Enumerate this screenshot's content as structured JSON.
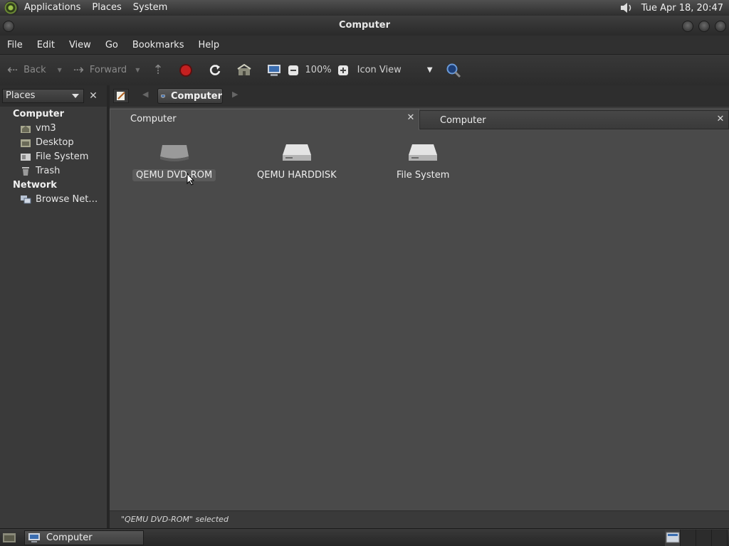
{
  "top_panel": {
    "menus": [
      "Applications",
      "Places",
      "System"
    ],
    "clock": "Tue Apr 18, 20:47",
    "icons": [
      "gnome-foot-icon",
      "volume-icon"
    ]
  },
  "window": {
    "title": "Computer",
    "controls": [
      "minimize-icon",
      "maximize-icon",
      "close-icon"
    ]
  },
  "menubar": [
    "File",
    "Edit",
    "View",
    "Go",
    "Bookmarks",
    "Help"
  ],
  "toolbar": {
    "back_label": "Back",
    "forward_label": "Forward",
    "zoom_level": "100%",
    "view_mode": "Icon View",
    "icons": [
      "up-icon",
      "stop-icon",
      "reload-icon",
      "home-icon",
      "computer-icon",
      "zoom-out-icon",
      "zoom-in-icon",
      "search-icon"
    ]
  },
  "location": {
    "pane_selector": "Places",
    "breadcrumb": "Computer"
  },
  "sidebar": {
    "sections": [
      {
        "heading": "Computer",
        "items": [
          {
            "label": "vm3",
            "icon": "home-folder-icon"
          },
          {
            "label": "Desktop",
            "icon": "desktop-icon"
          },
          {
            "label": "File System",
            "icon": "drive-icon"
          },
          {
            "label": "Trash",
            "icon": "trash-icon"
          }
        ]
      },
      {
        "heading": "Network",
        "items": [
          {
            "label": "Browse Net…",
            "icon": "network-icon"
          }
        ]
      }
    ]
  },
  "tabs": [
    {
      "label": "Computer",
      "active": true
    },
    {
      "label": "Computer",
      "active": false
    }
  ],
  "drives": [
    {
      "label": "QEMU DVD-ROM",
      "icon": "optical-drive-icon",
      "selected": true
    },
    {
      "label": "QEMU HARDDISK",
      "icon": "harddisk-icon",
      "selected": false
    },
    {
      "label": "File System",
      "icon": "filesystem-icon",
      "selected": false
    }
  ],
  "status": "\"QEMU DVD-ROM\" selected",
  "taskbar": {
    "window_button": "Computer"
  }
}
